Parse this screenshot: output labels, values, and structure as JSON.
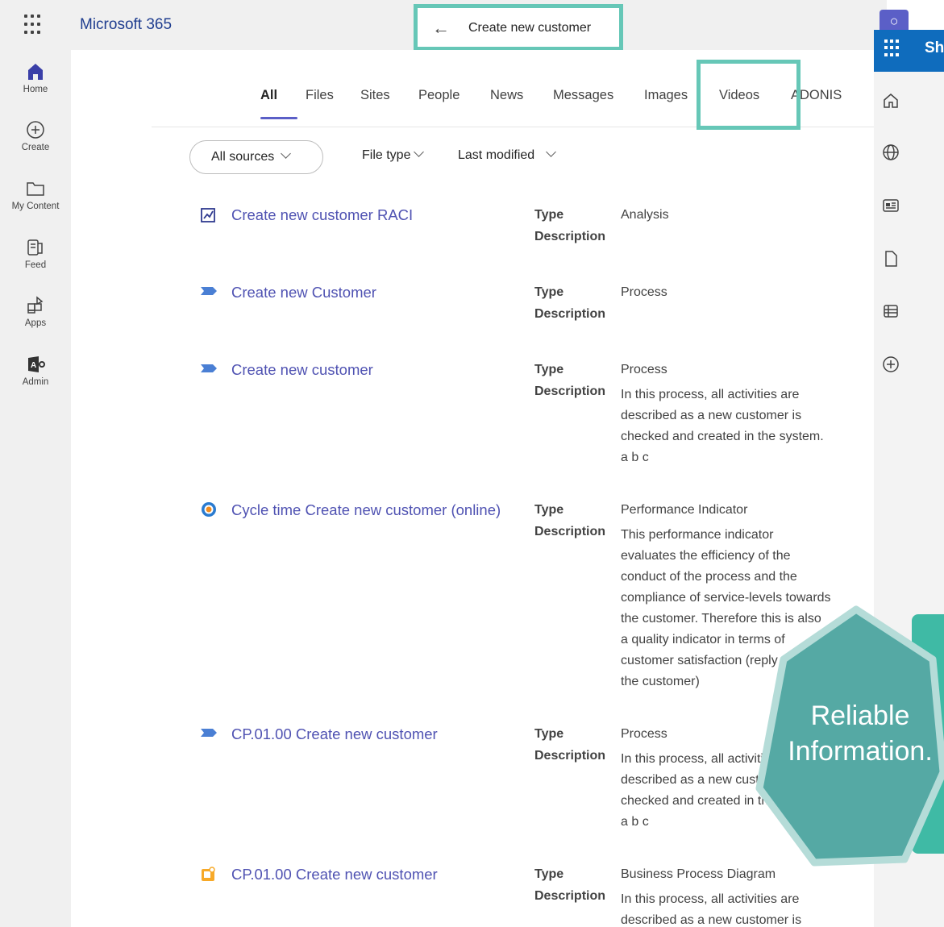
{
  "header": {
    "app_name": "Microsoft 365",
    "search_query": "Create new customer"
  },
  "left_rail": [
    {
      "label": "Home",
      "icon": "home-icon"
    },
    {
      "label": "Create",
      "icon": "add-circle-icon"
    },
    {
      "label": "My Content",
      "icon": "folder-icon"
    },
    {
      "label": "Feed",
      "icon": "feed-icon"
    },
    {
      "label": "Apps",
      "icon": "apps-icon"
    },
    {
      "label": "Admin",
      "icon": "admin-icon"
    }
  ],
  "tabs": [
    "All",
    "Files",
    "Sites",
    "People",
    "News",
    "Messages",
    "Images",
    "Videos",
    "ADONIS"
  ],
  "active_tab": "All",
  "filters": {
    "sources": "All sources",
    "file_type": "File type",
    "last_modified": "Last modified"
  },
  "field_labels": {
    "type": "Type",
    "description": "Description"
  },
  "results": [
    {
      "title": "Create new customer RACI",
      "type": "Analysis",
      "description": "",
      "icon": "analysis-icon"
    },
    {
      "title": "Create new Customer",
      "type": "Process",
      "description": "",
      "icon": "process-icon"
    },
    {
      "title": "Create new customer",
      "type": "Process",
      "description": "In this process, all activities are described as a new customer is checked and created in the system. a b c",
      "icon": "process-icon"
    },
    {
      "title": "Cycle time Create new customer (online)",
      "type": "Performance Indicator",
      "description": "This performance indicator evaluates the efficiency of the conduct of the process and the compliance of service-levels towards the customer. Therefore this is also a quality indicator in terms of customer satisfaction (reply time to the customer)",
      "icon": "performance-indicator-icon"
    },
    {
      "title": "CP.01.00 Create new customer",
      "type": "Process",
      "description": "In this process, all activities are described as a new customer is checked and created in the system. a b c",
      "icon": "process-icon"
    },
    {
      "title": "CP.01.00 Create new customer",
      "type": "Business Process Diagram",
      "description": "In this process, all activities are described as a new customer is",
      "icon": "business-process-diagram-icon"
    }
  ],
  "right_panel": {
    "title": "Sh",
    "icons": [
      "home-outline-icon",
      "globe-icon",
      "news-icon",
      "document-icon",
      "list-icon",
      "add-circle-icon"
    ]
  },
  "badge": {
    "line1": "Reliable",
    "line2": "Information."
  },
  "colors": {
    "accent": "#5b5fc7",
    "link": "#4f52b2",
    "highlight": "#66c7b7",
    "badge": "#55a9a4",
    "sharepoint": "#0f6cbd"
  }
}
